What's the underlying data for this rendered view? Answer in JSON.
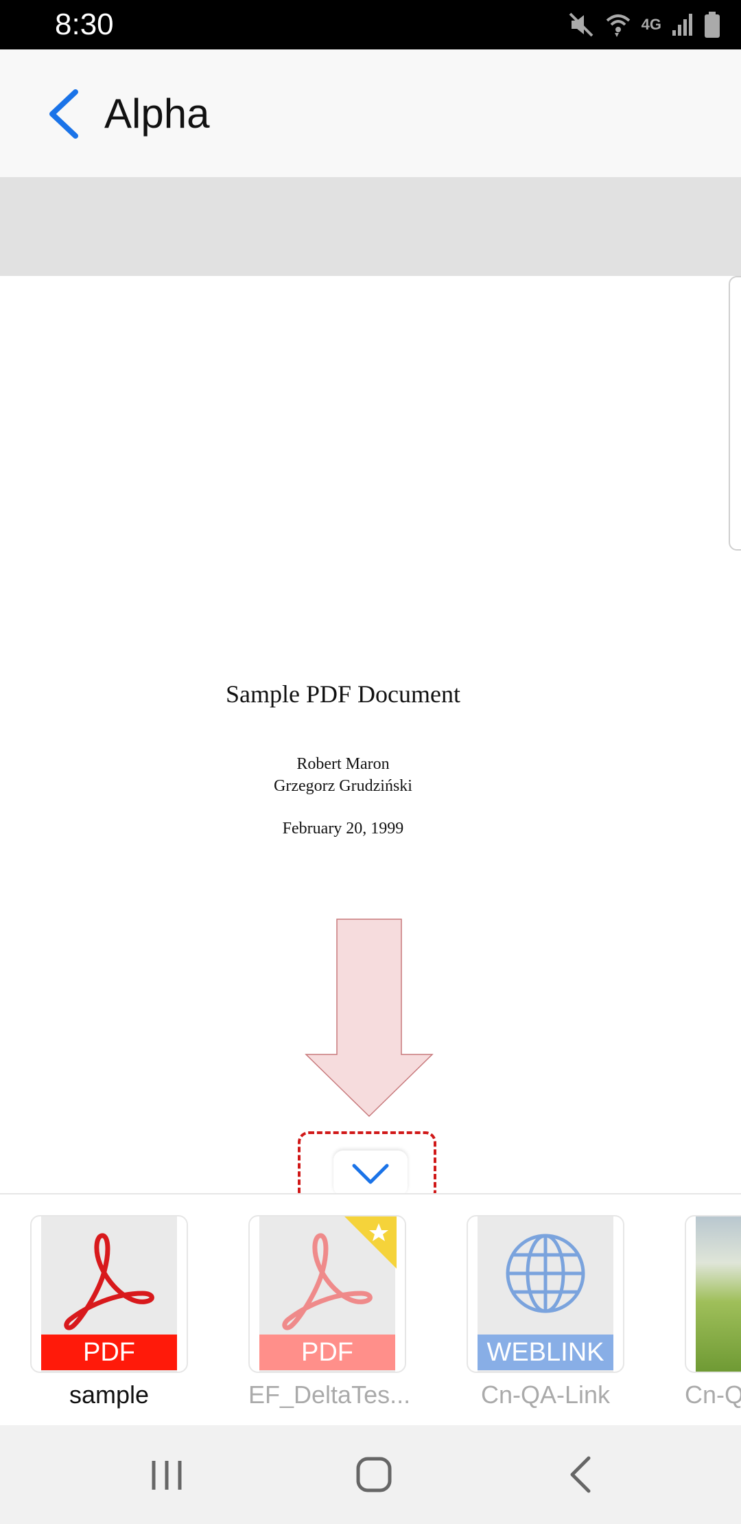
{
  "status_bar": {
    "time": "8:30",
    "network": "4G",
    "icons": [
      "mute-icon",
      "wifi-icon",
      "signal-icon",
      "battery-icon"
    ]
  },
  "app_bar": {
    "title": "Alpha",
    "back_icon": "chevron-left-icon"
  },
  "document": {
    "title": "Sample PDF Document",
    "authors": [
      "Robert Maron",
      "Grzegorz Grudziński"
    ],
    "date": "February 20, 1999"
  },
  "collapse_button": {
    "icon": "chevron-down-icon"
  },
  "tray": {
    "items": [
      {
        "label": "sample",
        "type_badge": "PDF",
        "badge_color": "#ff1a0a",
        "active": true
      },
      {
        "label": "EF_DeltaTes...",
        "type_badge": "PDF",
        "badge_color": "#ff8f8a",
        "favorite": true,
        "active": false
      },
      {
        "label": "Cn-QA-Link",
        "type_badge": "WEBLINK",
        "badge_color": "#88aee6",
        "active": false
      },
      {
        "label": "Cn-Q",
        "active": false
      }
    ]
  },
  "nav_bar": {
    "buttons": [
      "recents-icon",
      "home-icon",
      "back-icon"
    ]
  },
  "colors": {
    "accent": "#1a73e8",
    "hint_border": "#d01818",
    "hint_arrow": "#f6dcdd"
  }
}
